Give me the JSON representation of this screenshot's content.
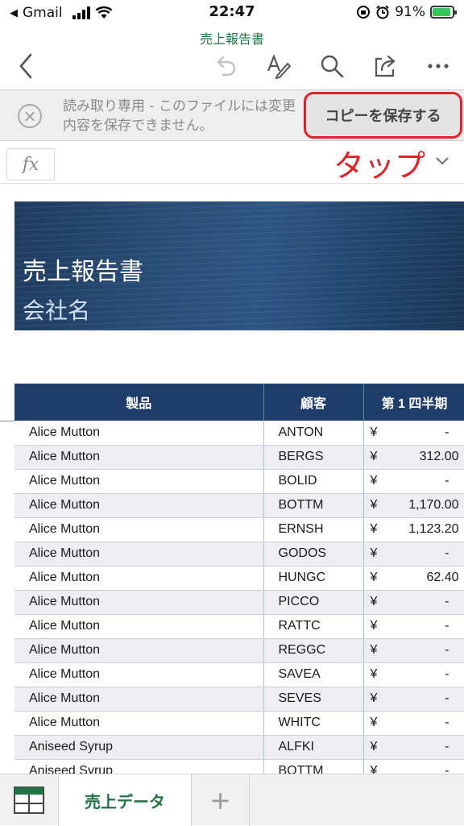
{
  "status_bar": {
    "back_app": "Gmail",
    "time": "22:47",
    "battery": "91%",
    "battery_level": 0.91
  },
  "document": {
    "title": "売上報告書"
  },
  "toolbar": {
    "icons": [
      "back-chevron-icon",
      "undo-icon",
      "pen-format-icon",
      "search-icon",
      "share-icon",
      "more-icon"
    ]
  },
  "readonly_bar": {
    "message": "読み取り専用 - このファイルには変更内容を保存できません。",
    "save_copy_label": "コピーを保存する"
  },
  "formula_bar": {
    "fx_label": "fx",
    "annotation": "タップ"
  },
  "banner": {
    "title": "売上報告書",
    "subtitle": "会社名"
  },
  "table": {
    "headers": [
      "製品",
      "顧客",
      "第 1 四半期"
    ],
    "currency": "¥",
    "rows": [
      {
        "product": "Alice Mutton",
        "customer": "ANTON",
        "q1": "-"
      },
      {
        "product": "Alice Mutton",
        "customer": "BERGS",
        "q1": "312.00"
      },
      {
        "product": "Alice Mutton",
        "customer": "BOLID",
        "q1": "-"
      },
      {
        "product": "Alice Mutton",
        "customer": "BOTTM",
        "q1": "1,170.00"
      },
      {
        "product": "Alice Mutton",
        "customer": "ERNSH",
        "q1": "1,123.20"
      },
      {
        "product": "Alice Mutton",
        "customer": "GODOS",
        "q1": "-"
      },
      {
        "product": "Alice Mutton",
        "customer": "HUNGC",
        "q1": "62.40"
      },
      {
        "product": "Alice Mutton",
        "customer": "PICCO",
        "q1": "-"
      },
      {
        "product": "Alice Mutton",
        "customer": "RATTC",
        "q1": "-"
      },
      {
        "product": "Alice Mutton",
        "customer": "REGGC",
        "q1": "-"
      },
      {
        "product": "Alice Mutton",
        "customer": "SAVEA",
        "q1": "-"
      },
      {
        "product": "Alice Mutton",
        "customer": "SEVES",
        "q1": "-"
      },
      {
        "product": "Alice Mutton",
        "customer": "WHITC",
        "q1": "-"
      },
      {
        "product": "Aniseed Syrup",
        "customer": "ALFKI",
        "q1": "-"
      },
      {
        "product": "Aniseed Syrup",
        "customer": "BOTTM",
        "q1": "-"
      }
    ]
  },
  "sheet_tabs": {
    "active": "売上データ",
    "add_label": "+"
  },
  "colors": {
    "excel_green": "#217346",
    "header_navy": "#1f3d6b",
    "annotation_red": "#e0222a"
  }
}
